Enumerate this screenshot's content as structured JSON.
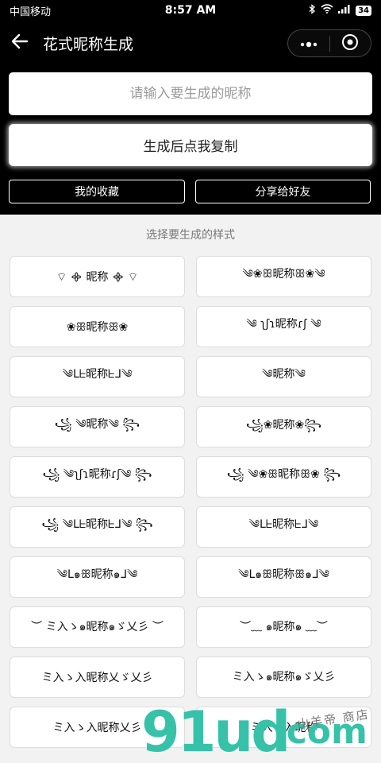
{
  "status": {
    "carrier": "中国移动",
    "time": "8:57 AM",
    "battery": "34"
  },
  "nav": {
    "title": "花式昵称生成"
  },
  "input": {
    "placeholder": "请输入要生成的昵称",
    "value": ""
  },
  "buttons": {
    "generate": "生成后点我复制",
    "favorites": "我的收藏",
    "share": "分享给好友"
  },
  "section_title": "选择要生成的样式",
  "styles": [
    "⌔ ᯽ 昵称 ᯽ ⌔",
    "༄❀ꕥ昵称ꕥ❀༄",
    "❀ꕥ昵称ꕥ❀",
    "༄ ʅʃɿ昵称ɾʃ ༄",
    "༄ᒪᖶ昵称ᖶᒧ༄",
    "༄昵称༄",
    "꧁ ༄昵称༄ ꧂",
    "꧁❀昵称❀꧂",
    "꧁ ༄ʅʃɿ昵称ɾʃ༄ ꧂",
    "꧁ ༄❀ꕥ昵称ꕥ❀ ꧂",
    "꧁ ༄ᒪᖶ昵称ᖶᒧ༄ ꧂",
    "༄ᒪᖶ昵称ᖶᒧ༄",
    "༄ᒪ๑ꕥ昵称๑ᒧ༄",
    "༄ᒪ๑ꕥ昵称ꕥ๑ᒧ༄",
    "︶ ミ入ゝ๑昵称๑ゞ乂彡 ︶",
    "︶﹏ ๑昵称๑ ﹏︶",
    "ミ入ゝ入昵称乂ゞ乂彡",
    "ミ入ゝ๑昵称๑ゞ乂彡",
    "ミ入ゝ入昵称乂彡",
    "ミ入ゝ入昵称"
  ],
  "watermark": {
    "main": "91ud",
    "dot_com": ".com",
    "sub": "山羊帝 商店"
  },
  "colors": {
    "header_bg": "#000000",
    "page_bg": "#f2f2f2",
    "watermark": "#36c2a8"
  }
}
